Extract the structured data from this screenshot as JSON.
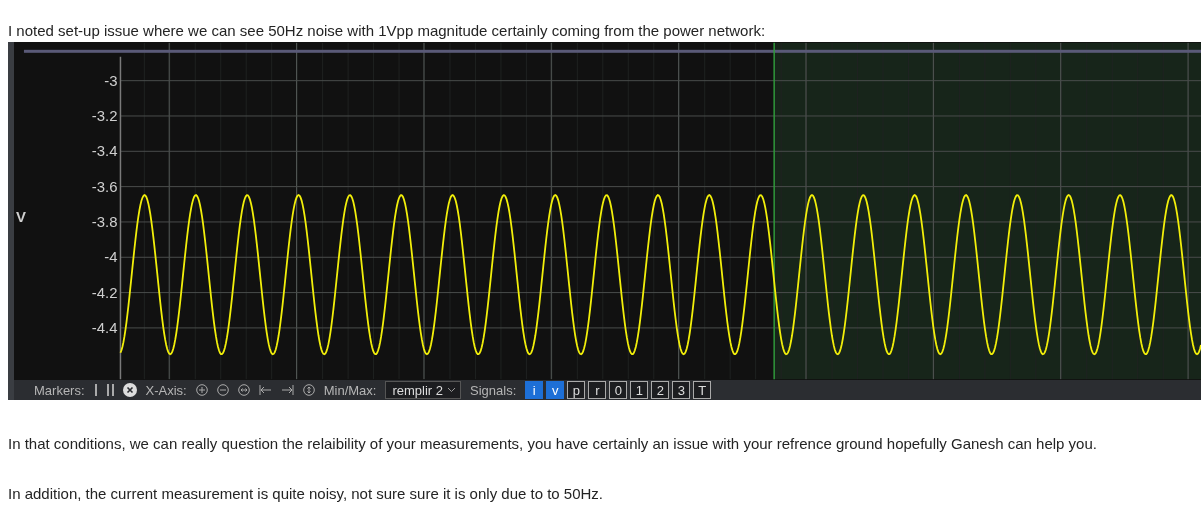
{
  "intro": "I noted set-up issue where we can see 50Hz noise with 1Vpp magnitude certainly coming from the power network:",
  "scope": {
    "y_unit": "V",
    "y_tick_labels": [
      "-3",
      "-3.2",
      "-3.4",
      "-3.6",
      "-3.8",
      "-4",
      "-4.2",
      "-4.4"
    ],
    "toolbar": {
      "markers_label": "Markers:",
      "x_axis_label": "X-Axis:",
      "minmax_label": "Min/Max:",
      "minmax_value": "remplir 2",
      "signals_label": "Signals:",
      "signals": [
        {
          "label": "i",
          "selected": true
        },
        {
          "label": "v",
          "selected": true
        },
        {
          "label": "p",
          "selected": false
        },
        {
          "label": "r",
          "selected": false
        },
        {
          "label": "0",
          "selected": false
        },
        {
          "label": "1",
          "selected": false
        },
        {
          "label": "2",
          "selected": false
        },
        {
          "label": "3",
          "selected": false
        },
        {
          "label": "T",
          "selected": false
        }
      ]
    }
  },
  "paragraphs": [
    "In that conditions, we can really question the relaibility of your measurements, you have certainly an issue with your refrence ground hopefully Ganesh can help you.",
    "In addition, the current measurement is quite noisy, not sure sure it is only due to to 50Hz."
  ]
}
